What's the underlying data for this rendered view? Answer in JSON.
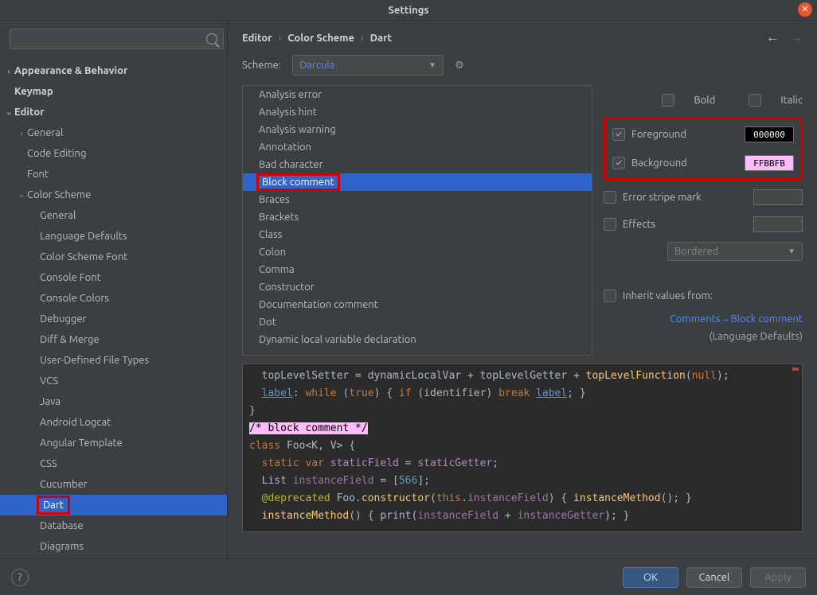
{
  "title": "Settings",
  "breadcrumb": [
    "Editor",
    "Color Scheme",
    "Dart"
  ],
  "scheme": {
    "label": "Scheme:",
    "value": "Darcula"
  },
  "sidebar": {
    "items": [
      {
        "label": "Appearance & Behavior",
        "depth": 0,
        "bold": true,
        "chevron": "right"
      },
      {
        "label": "Keymap",
        "depth": 0,
        "bold": true
      },
      {
        "label": "Editor",
        "depth": 0,
        "bold": true,
        "chevron": "down"
      },
      {
        "label": "General",
        "depth": 1,
        "chevron": "right"
      },
      {
        "label": "Code Editing",
        "depth": 1
      },
      {
        "label": "Font",
        "depth": 1
      },
      {
        "label": "Color Scheme",
        "depth": 1,
        "chevron": "down"
      },
      {
        "label": "General",
        "depth": 2
      },
      {
        "label": "Language Defaults",
        "depth": 2
      },
      {
        "label": "Color Scheme Font",
        "depth": 2
      },
      {
        "label": "Console Font",
        "depth": 2
      },
      {
        "label": "Console Colors",
        "depth": 2
      },
      {
        "label": "Debugger",
        "depth": 2
      },
      {
        "label": "Diff & Merge",
        "depth": 2
      },
      {
        "label": "User-Defined File Types",
        "depth": 2
      },
      {
        "label": "VCS",
        "depth": 2
      },
      {
        "label": "Java",
        "depth": 2
      },
      {
        "label": "Android Logcat",
        "depth": 2
      },
      {
        "label": "Angular Template",
        "depth": 2
      },
      {
        "label": "CSS",
        "depth": 2
      },
      {
        "label": "Cucumber",
        "depth": 2
      },
      {
        "label": "Dart",
        "depth": 2,
        "selected": true,
        "highlight": true
      },
      {
        "label": "Database",
        "depth": 2
      },
      {
        "label": "Diagrams",
        "depth": 2
      }
    ]
  },
  "attributes": [
    "Analysis error",
    "Analysis hint",
    "Analysis warning",
    "Annotation",
    "Bad character",
    "Block comment",
    "Braces",
    "Brackets",
    "Class",
    "Colon",
    "Comma",
    "Constructor",
    "Documentation comment",
    "Dot",
    "Dynamic local variable declaration"
  ],
  "attr_selected": "Block comment",
  "opts": {
    "bold": "Bold",
    "italic": "Italic",
    "foreground": "Foreground",
    "background": "Background",
    "errorstripe": "Error stripe mark",
    "effects": "Effects",
    "effects_value": "Bordered",
    "fg_value": "000000",
    "bg_value": "FFBBFB",
    "inherit_lbl": "Inherit values from:",
    "inherit_link": "Comments→Block comment",
    "inherit_note": "(Language Defaults)"
  },
  "buttons": {
    "ok": "OK",
    "cancel": "Cancel",
    "apply": "Apply",
    "help": "?"
  },
  "preview": {
    "l1a": "  topLevelSetter = dynamicLocalVar + topLevelGetter + ",
    "l1b": "topLevelFunction",
    "l1c": "(",
    "l1d": "null",
    "l1e": ");",
    "l2a": "  ",
    "l2b": "label",
    "l2c": ": ",
    "l2d": "while",
    "l2e": " (",
    "l2f": "true",
    "l2g": ") { ",
    "l2h": "if",
    "l2i": " (identifier) ",
    "l2j": "break",
    "l2k": " ",
    "l2l": "label",
    "l2m": "; }",
    "l3": "}",
    "l4": "/* block comment */",
    "l5a": "class ",
    "l5b": "Foo",
    "l5c": "<K, V> {",
    "l6a": "  ",
    "l6b": "static var ",
    "l6c": "staticField",
    "l6d": " = ",
    "l6e": "staticGetter",
    "l6f": ";",
    "l7a": "  List ",
    "l7b": "instanceField",
    "l7c": " = [",
    "l7d": "566",
    "l7e": "];",
    "l8a": "  ",
    "l8b": "@deprecated",
    "l8c": " Foo.",
    "l8d": "constructor",
    "l8e": "(",
    "l8f": "this",
    "l8g": ".",
    "l8h": "instanceField",
    "l8i": ") { ",
    "l8j": "instanceMethod",
    "l8k": "(); }",
    "l9a": "  ",
    "l9b": "instanceMethod",
    "l9c": "() { print(",
    "l9d": "instanceField",
    "l9e": " + ",
    "l9f": "instanceGetter",
    "l9g": "); }"
  }
}
